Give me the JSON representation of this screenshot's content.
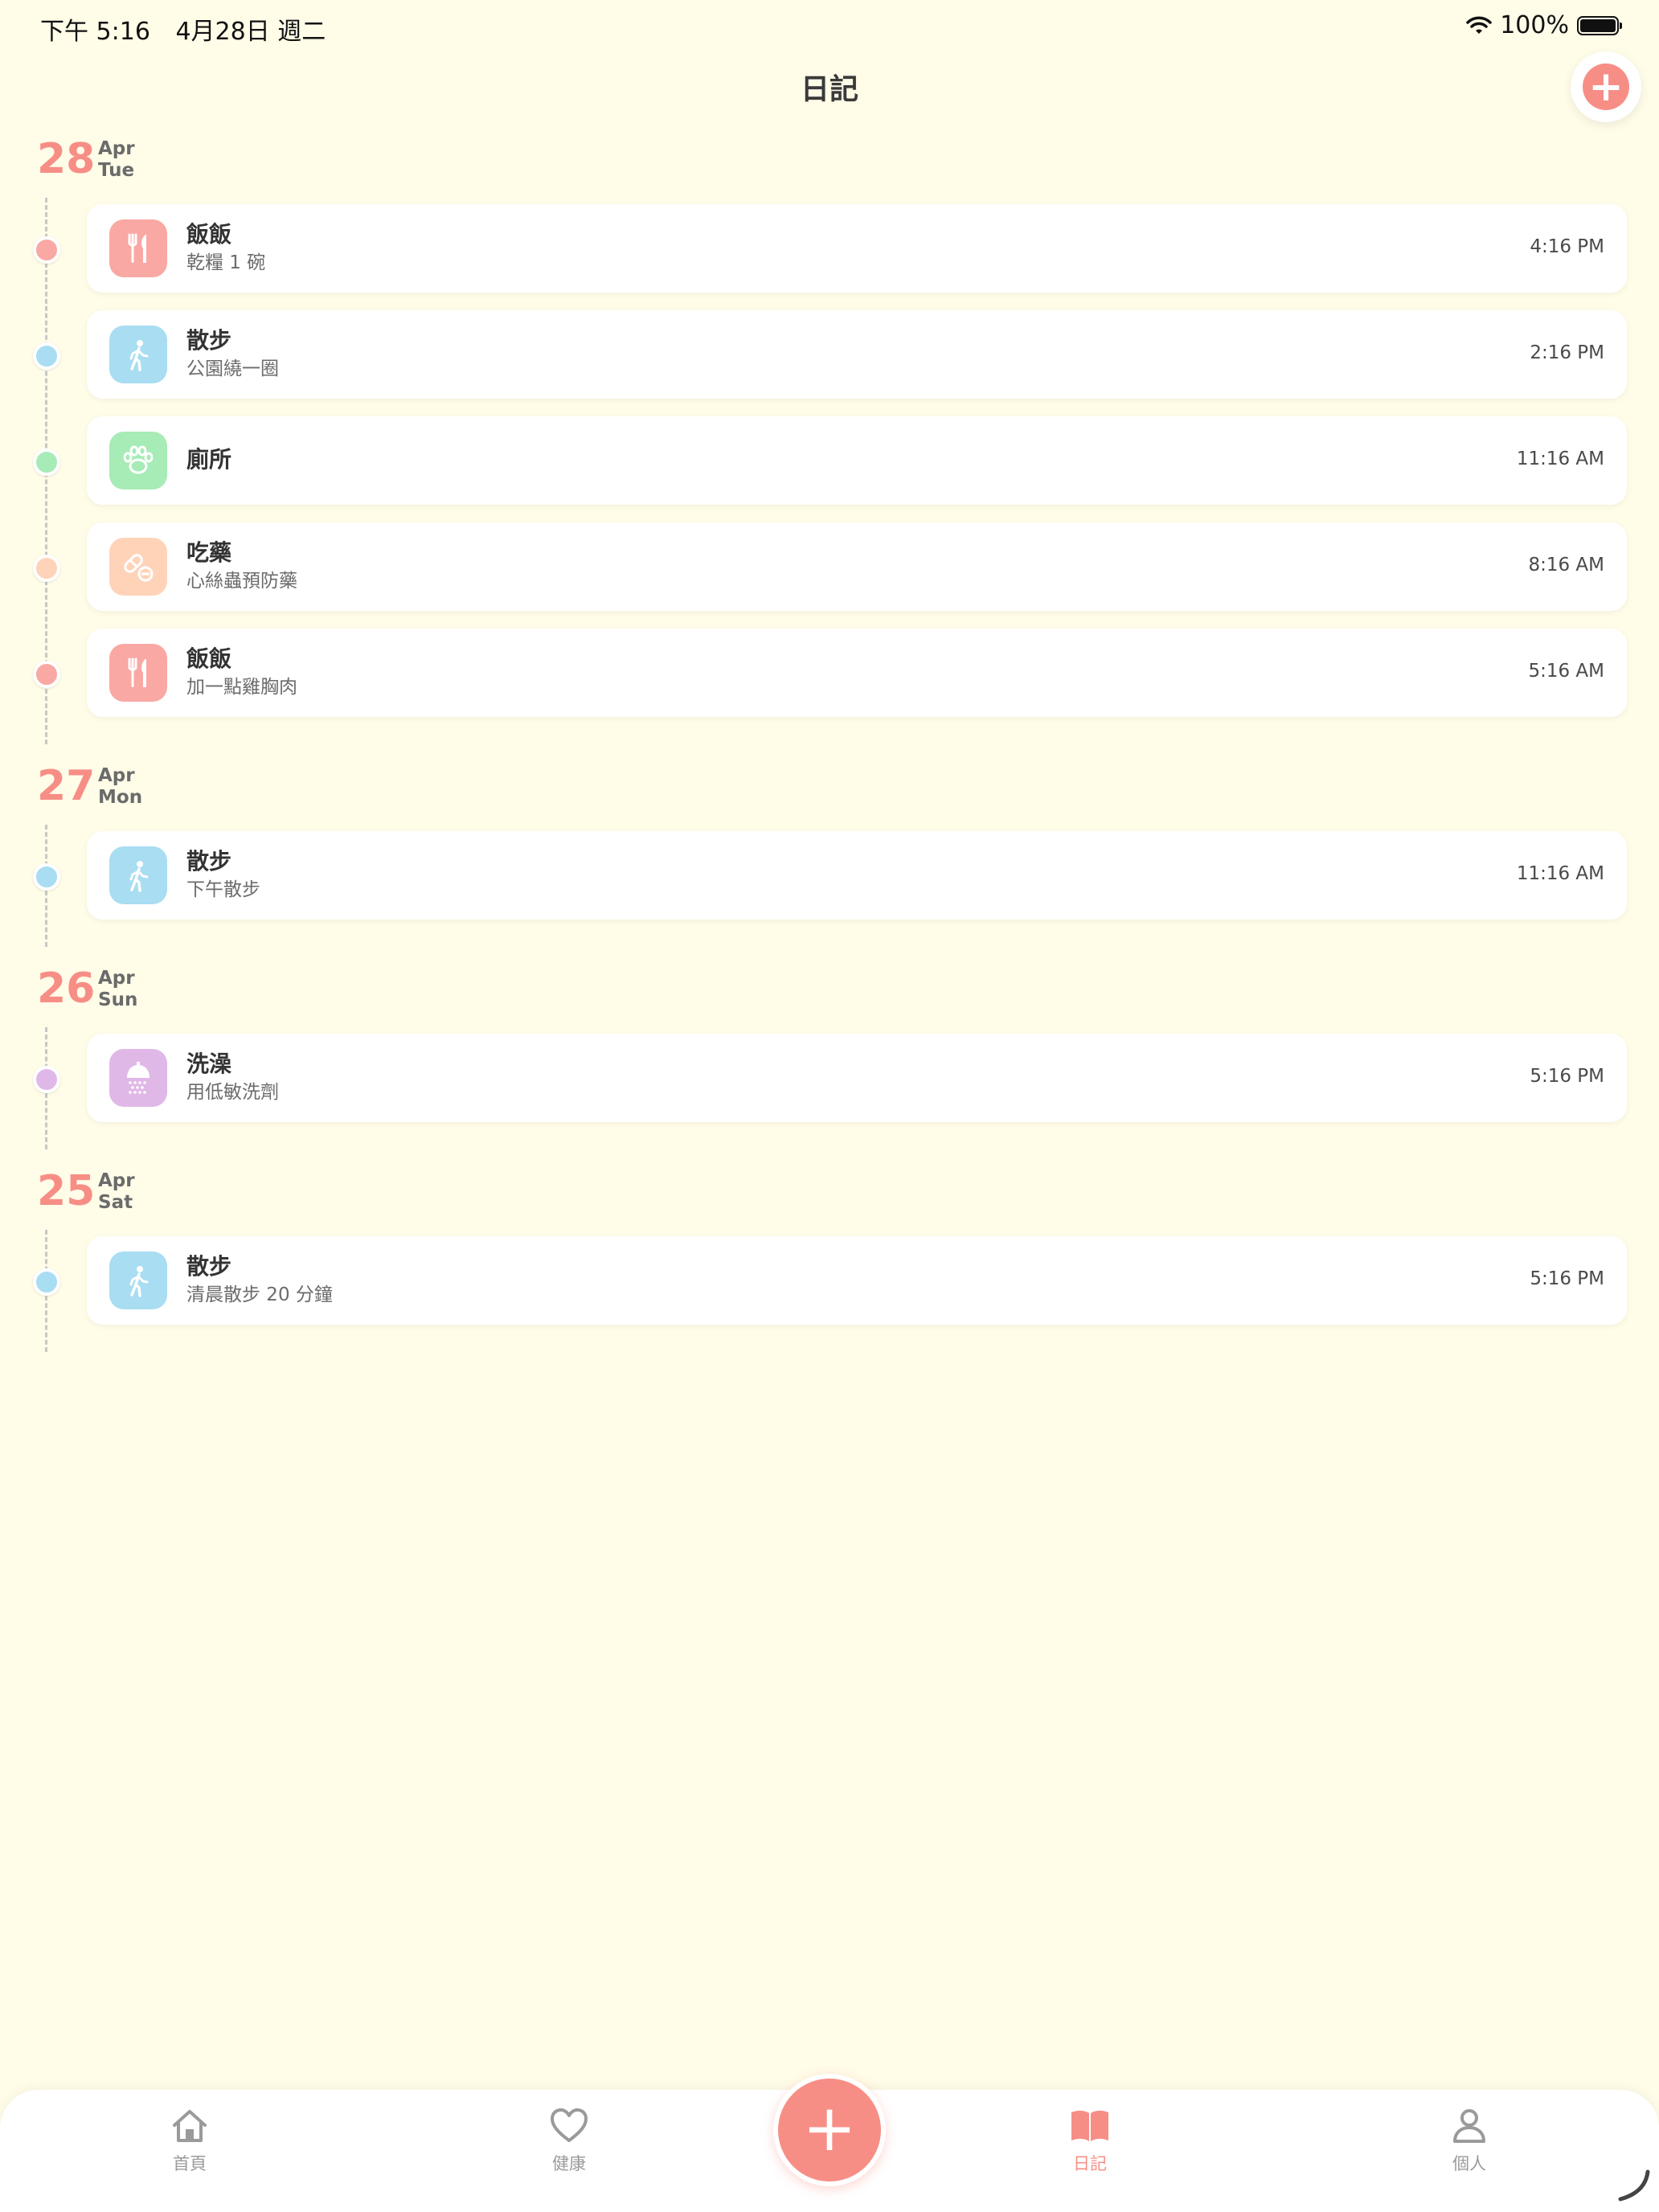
{
  "status_bar": {
    "time": "下午 5:16",
    "date": "4月28日 週二",
    "battery_percent": "100%",
    "battery_level": 1.0
  },
  "nav": {
    "title": "日記",
    "add_label": "+"
  },
  "colors": {
    "background": "#FFFCE8",
    "accent": "#F78E86",
    "meal": "#F9A8A3",
    "walk": "#A8DDF2",
    "toilet": "#A7EBB6",
    "medicine": "#FFD3B8",
    "bath": "#E0B8E8"
  },
  "days": [
    {
      "day": "28",
      "month": "Apr",
      "weekday": "Tue",
      "entries": [
        {
          "type": "meal",
          "icon": "utensils-icon",
          "title": "飯飯",
          "subtitle": "乾糧 1 碗",
          "time": "4:16 PM"
        },
        {
          "type": "walk",
          "icon": "walking-icon",
          "title": "散步",
          "subtitle": "公園繞一圈",
          "time": "2:16 PM"
        },
        {
          "type": "toilet",
          "icon": "paw-icon",
          "title": "廁所",
          "subtitle": "",
          "time": "11:16 AM"
        },
        {
          "type": "medicine",
          "icon": "pill-icon",
          "title": "吃藥",
          "subtitle": "心絲蟲預防藥",
          "time": "8:16 AM"
        },
        {
          "type": "meal",
          "icon": "utensils-icon",
          "title": "飯飯",
          "subtitle": "加一點雞胸肉",
          "time": "5:16 AM"
        }
      ]
    },
    {
      "day": "27",
      "month": "Apr",
      "weekday": "Mon",
      "entries": [
        {
          "type": "walk",
          "icon": "walking-icon",
          "title": "散步",
          "subtitle": "下午散步",
          "time": "11:16 AM"
        }
      ]
    },
    {
      "day": "26",
      "month": "Apr",
      "weekday": "Sun",
      "entries": [
        {
          "type": "bath",
          "icon": "shower-icon",
          "title": "洗澡",
          "subtitle": "用低敏洗劑",
          "time": "5:16 PM"
        }
      ]
    },
    {
      "day": "25",
      "month": "Apr",
      "weekday": "Sat",
      "entries": [
        {
          "type": "walk",
          "icon": "walking-icon",
          "title": "散步",
          "subtitle": "清晨散步 20 分鐘",
          "time": "5:16 PM"
        }
      ]
    }
  ],
  "tab_bar": {
    "center_add_label": "+",
    "tabs": [
      {
        "key": "home",
        "label": "首頁",
        "icon": "home-icon",
        "active": false
      },
      {
        "key": "health",
        "label": "健康",
        "icon": "heart-icon",
        "active": false
      },
      {
        "key": "diary",
        "label": "日記",
        "icon": "book-icon",
        "active": true
      },
      {
        "key": "profile",
        "label": "個人",
        "icon": "person-icon",
        "active": false
      }
    ]
  }
}
